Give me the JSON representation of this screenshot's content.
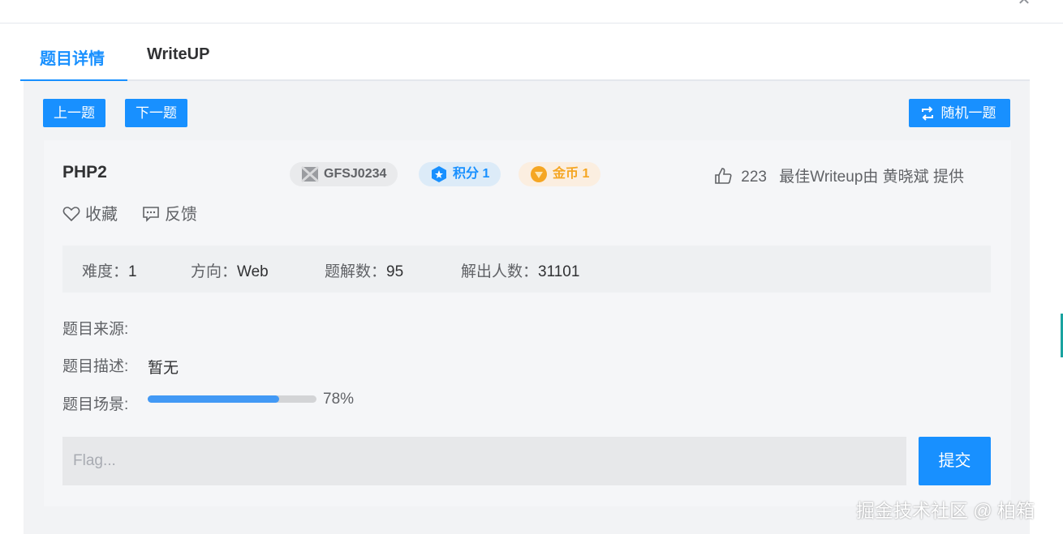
{
  "tabs": [
    {
      "label": "题目详情",
      "active": true
    },
    {
      "label": "WriteUP",
      "active": false
    }
  ],
  "nav": {
    "prev_label": "上一题",
    "next_label": "下一题",
    "random_label": "随机一题"
  },
  "challenge": {
    "title": "PHP2",
    "id": "GFSJ0234",
    "score_label": "积分 1",
    "coin_label": "金币 1",
    "likes": "223",
    "best_writeup": "最佳Writeup由 黄晓斌 提供",
    "favorite_label": "收藏",
    "feedback_label": "反馈"
  },
  "stats": {
    "difficulty_label": "难度：",
    "difficulty_value": "1",
    "direction_label": "方向：",
    "direction_value": "Web",
    "solutions_label": "题解数：",
    "solutions_value": "95",
    "solvers_label": "解出人数：",
    "solvers_value": "31101"
  },
  "details": {
    "source_label": "题目来源:",
    "source_value": "",
    "description_label": "题目描述:",
    "description_value": "暂无",
    "scene_label": "题目场景:",
    "scene_progress": 0.78,
    "scene_progress_text": "78%"
  },
  "flag": {
    "placeholder": "Flag...",
    "value": "",
    "submit_label": "提交"
  },
  "watermark": "掘金技术社区 @ 柏箱",
  "colors": {
    "accent": "#1890ff",
    "progress": "#4299f5",
    "coin": "#f5a623"
  }
}
